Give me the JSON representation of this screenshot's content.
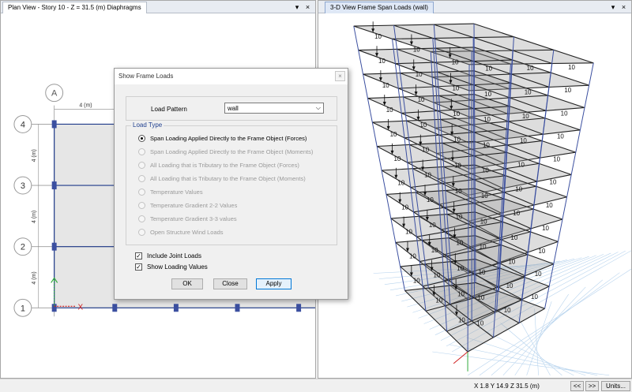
{
  "plan_view": {
    "tab_title": "Plan View - Story 10 - Z = 31.5 (m)  Diaphragms",
    "grid_column": "A",
    "grid_rows": [
      "4",
      "3",
      "2",
      "1"
    ],
    "dim_horizontal": "4 (m)",
    "dim_vertical": [
      "4 (m)",
      "4 (m)",
      "4 (m)"
    ],
    "axis_x": "X",
    "tab_controls": {
      "menu": "▾",
      "close": "×"
    }
  },
  "view_3d": {
    "tab_title": "3-D View  Frame Span Loads (wall)",
    "load_label": "10",
    "tab_controls": {
      "menu": "▾",
      "close": "×"
    }
  },
  "dialog": {
    "title": "Show Frame Loads",
    "close": "×",
    "load_pattern_label": "Load Pattern",
    "load_pattern_value": "wall",
    "load_type_legend": "Load Type",
    "options": [
      {
        "label": "Span Loading Applied Directly to the Frame Object (Forces)",
        "checked": true,
        "enabled": true
      },
      {
        "label": "Span Loading Applied Directly to the Frame Object (Moments)",
        "checked": false,
        "enabled": false
      },
      {
        "label": "All Loading that is Tributary to the Frame Object (Forces)",
        "checked": false,
        "enabled": false
      },
      {
        "label": "All Loading that is Tributary to the Frame Object (Moments)",
        "checked": false,
        "enabled": false
      },
      {
        "label": "Temperature Values",
        "checked": false,
        "enabled": false
      },
      {
        "label": "Temperature Gradient 2-2 Values",
        "checked": false,
        "enabled": false
      },
      {
        "label": "Temperature Gradient 3-3 values",
        "checked": false,
        "enabled": false
      },
      {
        "label": "Open Structure Wind Loads",
        "checked": false,
        "enabled": false
      }
    ],
    "include_joint_loads": {
      "label": "Include Joint Loads",
      "checked": true
    },
    "show_loading_values": {
      "label": "Show Loading Values",
      "checked": true
    },
    "buttons": {
      "ok": "OK",
      "close": "Close",
      "apply": "Apply"
    }
  },
  "status_bar": {
    "coordinates": "X 1.8  Y 14.9  Z 31.5 (m)",
    "prev": "<<",
    "next": ">>",
    "units": "Units..."
  },
  "colors": {
    "plan_grid": "#1f3a8a",
    "joint": "#3b4fa0",
    "slab": "#e6e6e6",
    "frame_3d": "#222222",
    "dialog_accent": "#0078d7"
  }
}
